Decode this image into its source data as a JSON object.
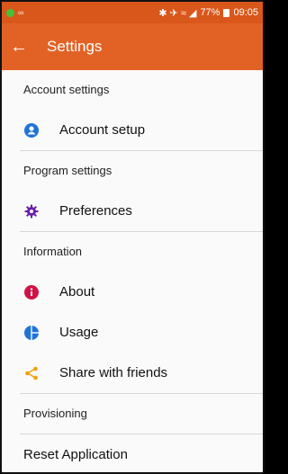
{
  "status": {
    "left_text": "∞",
    "icons_text": "✱ ✈ ≈ ◢",
    "battery": "77%",
    "time": "09:05"
  },
  "appbar": {
    "title": "Settings"
  },
  "sections": [
    {
      "header": "Account settings",
      "items": [
        {
          "label": "Account setup",
          "icon": "account-circle-icon",
          "color": "#1e73d8"
        }
      ]
    },
    {
      "header": "Program settings",
      "items": [
        {
          "label": "Preferences",
          "icon": "gear-icon",
          "color": "#6a1fa7"
        }
      ]
    },
    {
      "header": "Information",
      "items": [
        {
          "label": "About",
          "icon": "info-icon",
          "color": "#cf1346"
        },
        {
          "label": "Usage",
          "icon": "pie-chart-icon",
          "color": "#1e73d8"
        },
        {
          "label": "Share with friends",
          "icon": "share-icon",
          "color": "#f0a10c"
        }
      ]
    },
    {
      "header": "Provisioning",
      "items": [
        {
          "label": "Reset Application"
        }
      ]
    }
  ]
}
